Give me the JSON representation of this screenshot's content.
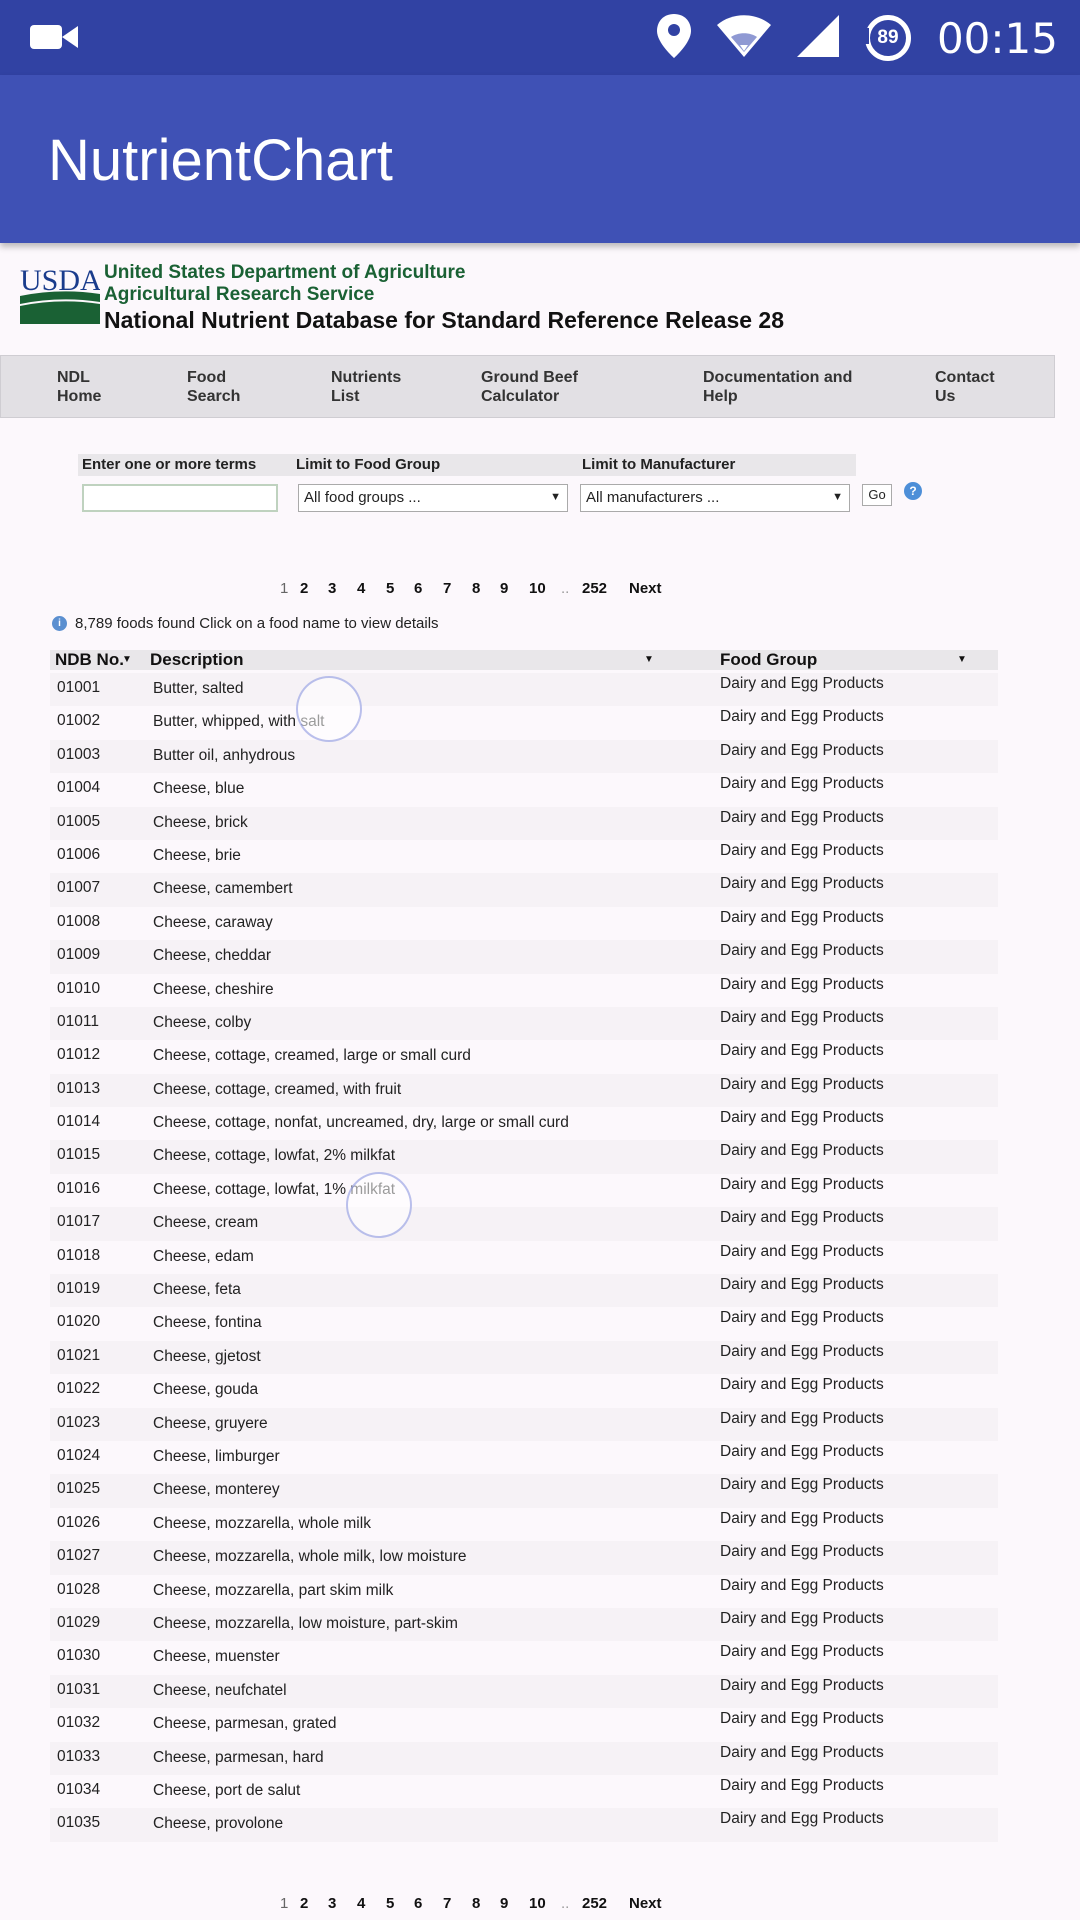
{
  "status_bar": {
    "time": "00:15",
    "battery_level": "89",
    "icons": [
      "video-camera-icon",
      "location-pin-icon",
      "wifi-icon",
      "cell-signal-icon",
      "battery-icon"
    ]
  },
  "app_bar": {
    "title": "NutrientChart"
  },
  "usda": {
    "logo_text": "USDA",
    "line1": "United States Department of Agriculture",
    "line2": "Agricultural Research Service",
    "line3": "National Nutrient Database for Standard Reference Release 28"
  },
  "nav": {
    "items": [
      {
        "label": "NDL\nHome"
      },
      {
        "label": "Food\nSearch"
      },
      {
        "label": "Nutrients\nList"
      },
      {
        "label": "Ground Beef\nCalculator"
      },
      {
        "label": "Documentation and\nHelp"
      },
      {
        "label": "Contact\nUs"
      }
    ]
  },
  "search": {
    "terms_label": "Enter one or more terms",
    "terms_value": "",
    "food_group_label": "Limit to Food Group",
    "food_group_selected": "All food groups ...",
    "manufacturer_label": "Limit to Manufacturer",
    "manufacturer_selected": "All manufacturers ...",
    "go_label": "Go",
    "help_glyph": "?"
  },
  "pager": {
    "current": "1",
    "pages": [
      "2",
      "3",
      "4",
      "5",
      "6",
      "7",
      "8",
      "9",
      "10"
    ],
    "ellipsis": "..",
    "last": "252",
    "next_label": "Next"
  },
  "results": {
    "info_glyph": "i",
    "info_text": "8,789 foods found Click on a food name to view details"
  },
  "table": {
    "headers": {
      "ndb": "NDB No.",
      "description": "Description",
      "food_group": "Food Group"
    },
    "rows": [
      {
        "id": "01001",
        "desc": "Butter, salted",
        "group": "Dairy and Egg Products"
      },
      {
        "id": "01002",
        "desc": "Butter, whipped, with salt",
        "group": "Dairy and Egg Products"
      },
      {
        "id": "01003",
        "desc": "Butter oil, anhydrous",
        "group": "Dairy and Egg Products"
      },
      {
        "id": "01004",
        "desc": "Cheese, blue",
        "group": "Dairy and Egg Products"
      },
      {
        "id": "01005",
        "desc": "Cheese, brick",
        "group": "Dairy and Egg Products"
      },
      {
        "id": "01006",
        "desc": "Cheese, brie",
        "group": "Dairy and Egg Products"
      },
      {
        "id": "01007",
        "desc": "Cheese, camembert",
        "group": "Dairy and Egg Products"
      },
      {
        "id": "01008",
        "desc": "Cheese, caraway",
        "group": "Dairy and Egg Products"
      },
      {
        "id": "01009",
        "desc": "Cheese, cheddar",
        "group": "Dairy and Egg Products"
      },
      {
        "id": "01010",
        "desc": "Cheese, cheshire",
        "group": "Dairy and Egg Products"
      },
      {
        "id": "01011",
        "desc": "Cheese, colby",
        "group": "Dairy and Egg Products"
      },
      {
        "id": "01012",
        "desc": "Cheese, cottage, creamed, large or small curd",
        "group": "Dairy and Egg Products"
      },
      {
        "id": "01013",
        "desc": "Cheese, cottage, creamed, with fruit",
        "group": "Dairy and Egg Products"
      },
      {
        "id": "01014",
        "desc": "Cheese, cottage, nonfat, uncreamed, dry, large or small curd",
        "group": "Dairy and Egg Products"
      },
      {
        "id": "01015",
        "desc": "Cheese, cottage, lowfat, 2% milkfat",
        "group": "Dairy and Egg Products"
      },
      {
        "id": "01016",
        "desc": "Cheese, cottage, lowfat, 1% milkfat",
        "group": "Dairy and Egg Products"
      },
      {
        "id": "01017",
        "desc": "Cheese, cream",
        "group": "Dairy and Egg Products"
      },
      {
        "id": "01018",
        "desc": "Cheese, edam",
        "group": "Dairy and Egg Products"
      },
      {
        "id": "01019",
        "desc": "Cheese, feta",
        "group": "Dairy and Egg Products"
      },
      {
        "id": "01020",
        "desc": "Cheese, fontina",
        "group": "Dairy and Egg Products"
      },
      {
        "id": "01021",
        "desc": "Cheese, gjetost",
        "group": "Dairy and Egg Products"
      },
      {
        "id": "01022",
        "desc": "Cheese, gouda",
        "group": "Dairy and Egg Products"
      },
      {
        "id": "01023",
        "desc": "Cheese, gruyere",
        "group": "Dairy and Egg Products"
      },
      {
        "id": "01024",
        "desc": "Cheese, limburger",
        "group": "Dairy and Egg Products"
      },
      {
        "id": "01025",
        "desc": "Cheese, monterey",
        "group": "Dairy and Egg Products"
      },
      {
        "id": "01026",
        "desc": "Cheese, mozzarella, whole milk",
        "group": "Dairy and Egg Products"
      },
      {
        "id": "01027",
        "desc": "Cheese, mozzarella, whole milk, low moisture",
        "group": "Dairy and Egg Products"
      },
      {
        "id": "01028",
        "desc": "Cheese, mozzarella, part skim milk",
        "group": "Dairy and Egg Products"
      },
      {
        "id": "01029",
        "desc": "Cheese, mozzarella, low moisture, part-skim",
        "group": "Dairy and Egg Products"
      },
      {
        "id": "01030",
        "desc": "Cheese, muenster",
        "group": "Dairy and Egg Products"
      },
      {
        "id": "01031",
        "desc": "Cheese, neufchatel",
        "group": "Dairy and Egg Products"
      },
      {
        "id": "01032",
        "desc": "Cheese, parmesan, grated",
        "group": "Dairy and Egg Products"
      },
      {
        "id": "01033",
        "desc": "Cheese, parmesan, hard",
        "group": "Dairy and Egg Products"
      },
      {
        "id": "01034",
        "desc": "Cheese, port de salut",
        "group": "Dairy and Egg Products"
      },
      {
        "id": "01035",
        "desc": "Cheese, provolone",
        "group": "Dairy and Egg Products"
      }
    ]
  },
  "colors": {
    "status_bar": "#3142a3",
    "app_bar": "#3f51b5",
    "usda_green": "#1a6134",
    "nav_bg": "#e2e0e4"
  }
}
